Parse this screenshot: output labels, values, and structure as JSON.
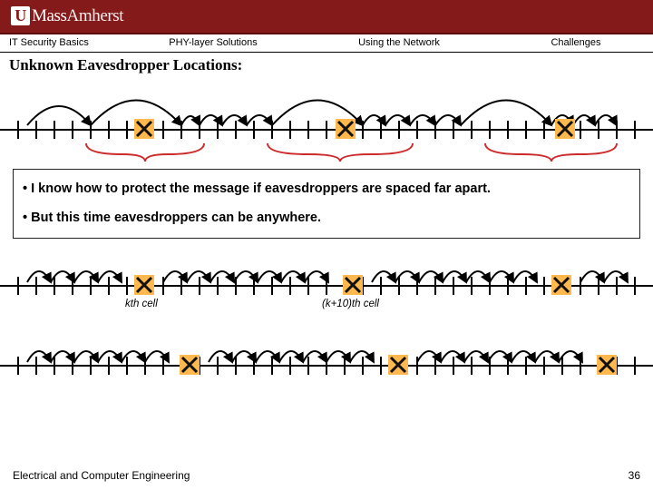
{
  "header": {
    "logo_u": "U",
    "logo_mass": "Mass",
    "logo_amh": "Amherst"
  },
  "tabs": {
    "t1": "IT Security Basics",
    "t2": "PHY-layer Solutions",
    "t3": "Using the Network",
    "t4": "Challenges"
  },
  "title": "Unknown Eavesdropper Locations:",
  "bullets": {
    "b1": "I know how to protect the message if eavesdroppers are spaced far apart.",
    "b2": "But this time eavesdroppers can be anywhere."
  },
  "labels": {
    "kth": "kth cell",
    "k10": "(k+10)th cell"
  },
  "footer": {
    "dept": "Electrical and Computer Engineering",
    "page": "36"
  }
}
